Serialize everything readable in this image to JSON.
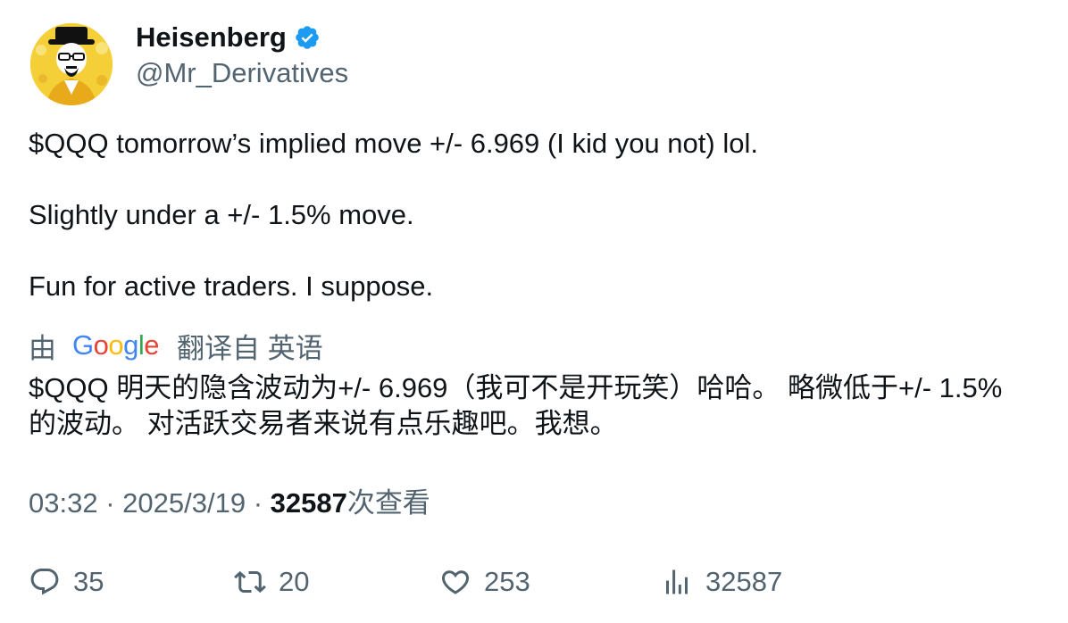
{
  "author": {
    "name": "Heisenberg",
    "handle": "@Mr_Derivatives",
    "verified": true,
    "avatar_icon": "heisenberg-portrait-avatar",
    "avatar_bg": "#f5cf38"
  },
  "tweet": {
    "lines": [
      "$QQQ tomorrow’s implied move +/- 6.969 (I kid you not) lol.",
      "Slightly under a +/- 1.5% move.",
      "Fun for active traders. I suppose."
    ]
  },
  "translation": {
    "by": "由",
    "logo_letters": [
      "G",
      "o",
      "o",
      "g",
      "l",
      "e"
    ],
    "logo_colors": [
      "#4285F4",
      "#EA4335",
      "#FBBC05",
      "#4285F4",
      "#34A853",
      "#EA4335"
    ],
    "label": "翻译自 英语",
    "lines": [
      "$QQQ 明天的隐含波动为+/- 6.969（我可不是开玩笑）哈哈。 略微低于+/- 1.5%",
      "的波动。 对活跃交易者来说有点乐趣吧。我想。"
    ]
  },
  "meta": {
    "time": "03:32",
    "separator": "·",
    "date": "2025/3/19",
    "views_number": "32587",
    "views_label": "次查看"
  },
  "actions": {
    "replies": "35",
    "retweets": "20",
    "likes": "253",
    "views": "32587"
  },
  "colors": {
    "text": "#0f1419",
    "secondary": "#536471",
    "verified": "#1d9bf0"
  }
}
